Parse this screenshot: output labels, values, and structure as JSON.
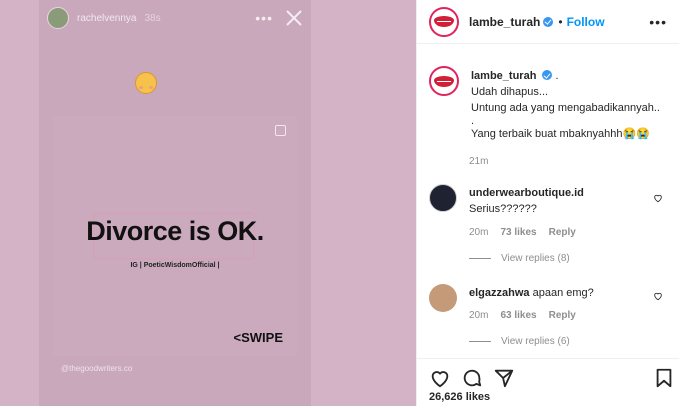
{
  "story": {
    "username": "rachelvennya",
    "time_ago": "38s",
    "more": "•••",
    "quote": "Divorce is OK.",
    "credit": "IG | PoeticWisdomOfficial |",
    "swipe": "<SWIPE",
    "source_tag": "@thegoodwriters.co"
  },
  "post": {
    "username": "lambe_turah",
    "follow_label": "Follow",
    "dot": "•",
    "more": "•••",
    "caption": {
      "username": "lambe_turah",
      "suffix": ".",
      "lines": [
        "Udah dihapus...",
        "Untung ada yang mengabadikannyah..",
        ".",
        "Yang terbaik buat mbaknyahhh😭😭"
      ],
      "time": "21m"
    },
    "comments": [
      {
        "username": "underwearboutique.id",
        "text": "Serius??????",
        "time": "20m",
        "likes": "73 likes",
        "reply": "Reply",
        "view_replies": "View replies (8)"
      },
      {
        "username": "elgazzahwa",
        "text": "apaan emg?",
        "time": "20m",
        "likes": "63 likes",
        "reply": "Reply",
        "view_replies": "View replies (6)"
      }
    ],
    "likes_count": "26,626 likes"
  },
  "icons": [
    "close-icon",
    "copy-icon",
    "verified-icon",
    "heart-icon",
    "comment-icon",
    "share-icon",
    "bookmark-icon"
  ],
  "colors": {
    "accent": "#0095f6",
    "verified": "#3897f0",
    "muted": "#8e8e8e",
    "story_bg": "#c9a8bc"
  }
}
